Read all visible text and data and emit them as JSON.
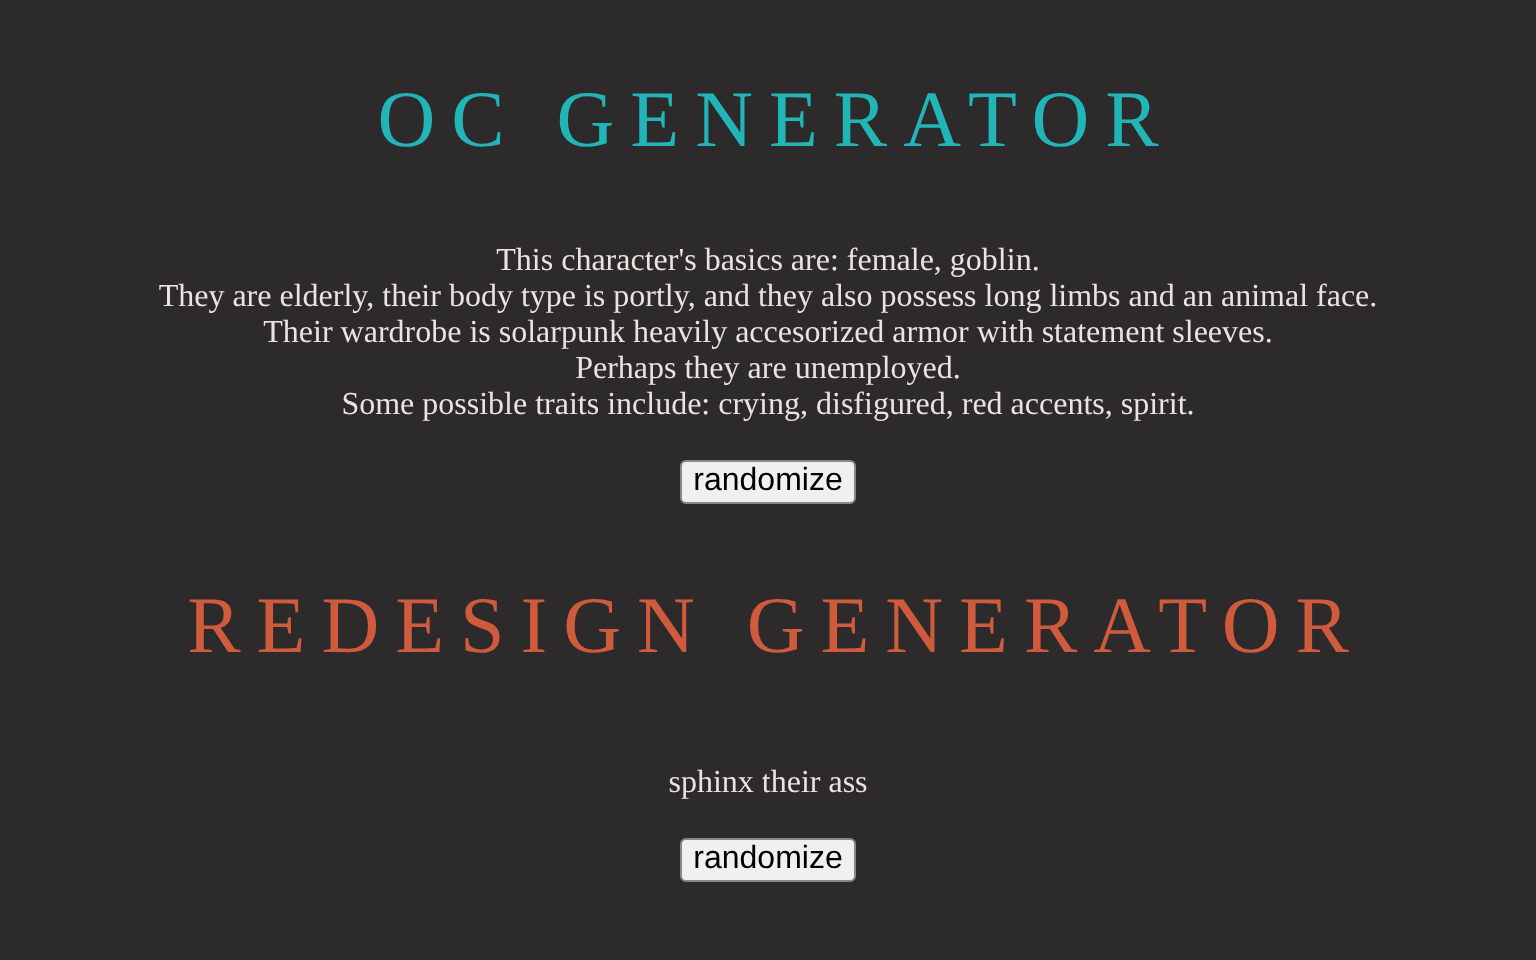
{
  "sections": [
    {
      "title": "OC GENERATOR",
      "color": "#22b5b8",
      "lines": [
        "This character's basics are: female, goblin.",
        "They are elderly, their body type is portly, and they also possess long limbs and an animal face.",
        "Their wardrobe is solarpunk heavily accesorized armor with statement sleeves.",
        "Perhaps they are unemployed.",
        "Some possible traits include: crying, disfigured, red accents, spirit."
      ],
      "button": "randomize"
    },
    {
      "title": "REDESIGN GENERATOR",
      "color": "#cf5a3c",
      "lines": [
        "sphinx their ass"
      ],
      "button": "randomize"
    }
  ]
}
